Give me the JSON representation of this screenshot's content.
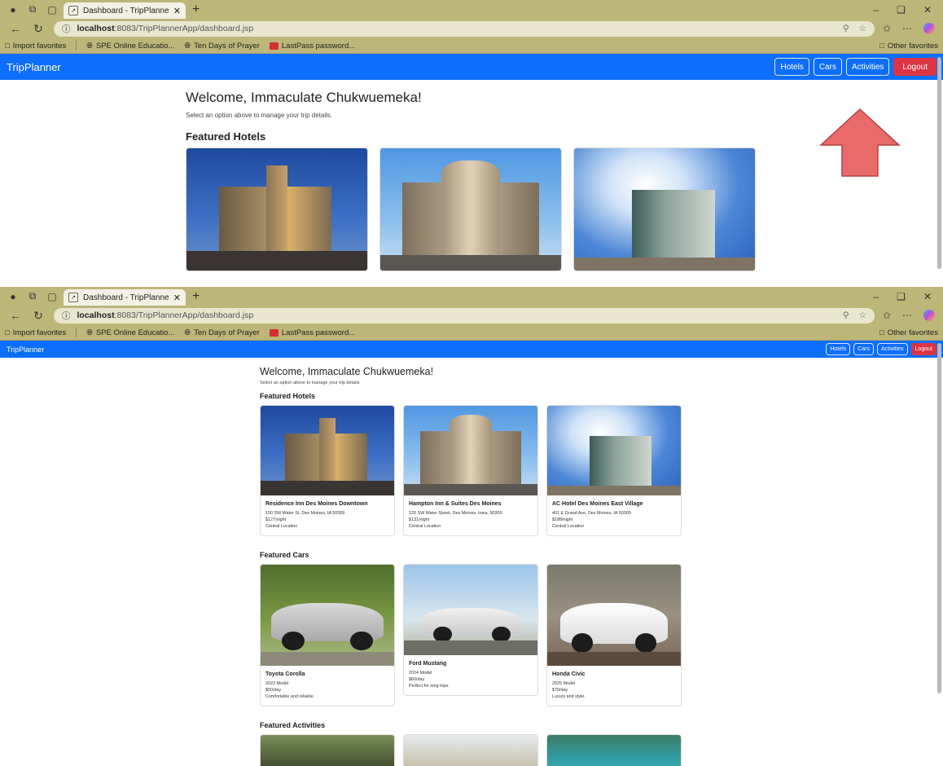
{
  "browser": {
    "tab_title": "Dashboard - TripPlanner",
    "url_host": "localhost",
    "url_path": ":8083/TripPlannerApp/dashboard.jsp",
    "favorites": [
      "Import favorites",
      "SPE Online Educatio...",
      "Ten Days of Prayer",
      "LastPass password..."
    ],
    "other_favorites": "Other favorites"
  },
  "app": {
    "brand": "TripPlanner",
    "nav": {
      "hotels": "Hotels",
      "cars": "Cars",
      "activities": "Activities",
      "logout": "Logout"
    },
    "welcome": "Welcome, Immaculate Chukwuemeka!",
    "subtitle": "Select an option above to manage your trip details.",
    "sections": {
      "hotels": "Featured Hotels",
      "cars": "Featured Cars",
      "activities": "Featured Activities"
    },
    "hotels": [
      {
        "name": "Residence Inn Des Moines Downtown",
        "address": "100 SW Water St, Des Moines, IA 50309",
        "price": "$127/night",
        "feature": "Central Location"
      },
      {
        "name": "Hampton Inn & Suites Des Moines",
        "address": "120 SW Water Street, Des Moines, Iowa, 50309",
        "price": "$131/night",
        "feature": "Central Location"
      },
      {
        "name": "AC Hotel Des Moines East Village",
        "address": "401 E Grand Ave, Des Moines, IA 50309",
        "price": "$188/night",
        "feature": "Central Location"
      }
    ],
    "cars": [
      {
        "name": "Toyota Corolla",
        "model": "2023 Model",
        "price": "$50/day",
        "desc": "Comfortable and reliable."
      },
      {
        "name": "Ford Mustang",
        "model": "2024 Model",
        "price": "$60/day",
        "desc": "Perfect for long trips."
      },
      {
        "name": "Honda Civic",
        "model": "2025 Model",
        "price": "$70/day",
        "desc": "Luxury and style."
      }
    ]
  },
  "colors": {
    "navbar": "#0d6efd",
    "logout": "#dc3545",
    "chrome": "#bdb679",
    "annotation_arrow": "#e86a6a"
  }
}
